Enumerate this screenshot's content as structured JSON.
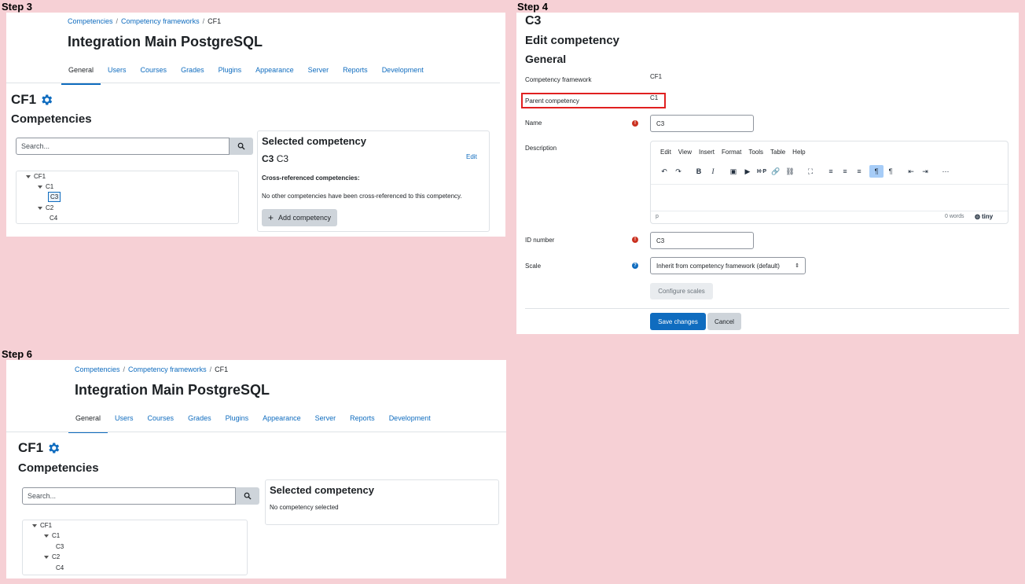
{
  "step3": {
    "label": "Step 3",
    "breadcrumb": [
      "Competencies",
      "Competency frameworks",
      "CF1"
    ],
    "site_title": "Integration Main PostgreSQL",
    "tabs": [
      "General",
      "Users",
      "Courses",
      "Grades",
      "Plugins",
      "Appearance",
      "Server",
      "Reports",
      "Development"
    ],
    "active_tab": "General",
    "framework_title": "CF1",
    "section_title": "Competencies",
    "search_placeholder": "Search...",
    "tree": [
      "CF1",
      "C1",
      "C3",
      "C2",
      "C4"
    ],
    "selected": {
      "title": "Selected competency",
      "short_name": "C3",
      "name": "C3",
      "edit_link": "Edit",
      "cross_ref_heading": "Cross-referenced competencies:",
      "cross_ref_text": "No other competencies have been cross-referenced to this competency.",
      "add_button": "Add competency"
    }
  },
  "step4": {
    "label": "Step 4",
    "heading": "C3",
    "subheading": "Edit competency",
    "section": "General",
    "fields": {
      "framework_label": "Competency framework",
      "framework_value": "CF1",
      "parent_label": "Parent competency",
      "parent_value": "C1",
      "name_label": "Name",
      "name_value": "C3",
      "description_label": "Description",
      "idnumber_label": "ID number",
      "idnumber_value": "C3",
      "scale_label": "Scale",
      "scale_value": "Inherit from competency framework (default)"
    },
    "editor": {
      "menu": [
        "Edit",
        "View",
        "Insert",
        "Format",
        "Tools",
        "Table",
        "Help"
      ],
      "status_path": "p",
      "word_count": "0 words",
      "brand": "tiny"
    },
    "configure_scales": "Configure scales",
    "save_button": "Save changes",
    "cancel_button": "Cancel",
    "highlight_color": "#e02020"
  },
  "step6": {
    "label": "Step 6",
    "breadcrumb": [
      "Competencies",
      "Competency frameworks",
      "CF1"
    ],
    "site_title": "Integration Main PostgreSQL",
    "tabs": [
      "General",
      "Users",
      "Courses",
      "Grades",
      "Plugins",
      "Appearance",
      "Server",
      "Reports",
      "Development"
    ],
    "framework_title": "CF1",
    "section_title": "Competencies",
    "search_placeholder": "Search...",
    "tree": [
      "CF1",
      "C1",
      "C3",
      "C2",
      "C4"
    ],
    "selected": {
      "title": "Selected competency",
      "empty_text": "No competency selected"
    }
  }
}
